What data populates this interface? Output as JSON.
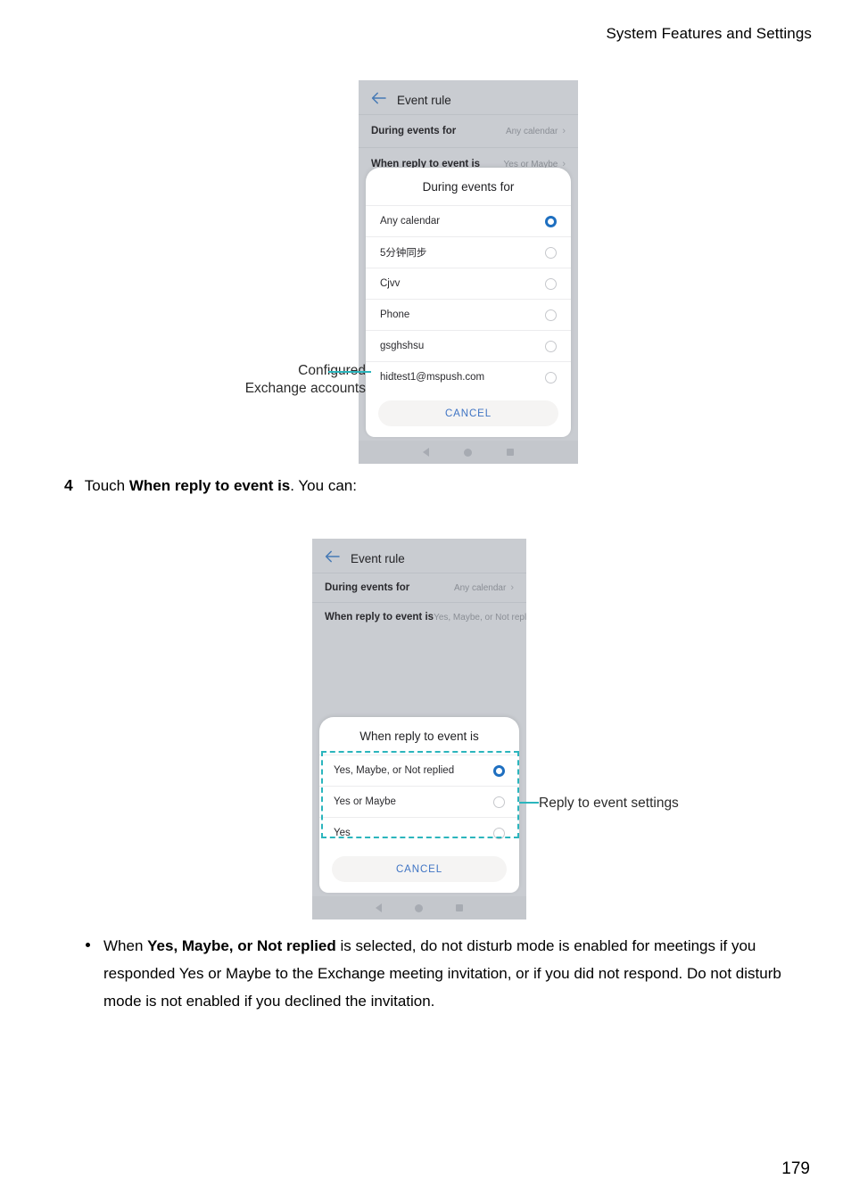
{
  "document": {
    "header": "System Features and Settings",
    "page_number": "179"
  },
  "step": {
    "number": "4",
    "text_before": "Touch ",
    "bold": "When reply to event is",
    "text_after": ". You can:"
  },
  "bullet": {
    "text_before": "When ",
    "bold": "Yes, Maybe, or Not replied",
    "text_after": " is selected, do not disturb mode is enabled for meetings if you responded Yes or Maybe to the Exchange meeting invitation, or if you did not respond. Do not disturb mode is not enabled if you declined the invitation."
  },
  "screenshot_one": {
    "appbar_title": "Event rule",
    "settings_rows": [
      {
        "label": "During events for",
        "value": "Any calendar"
      },
      {
        "label": "When reply to event is",
        "value": "Yes or Maybe"
      }
    ],
    "sheet_title": "During events for",
    "options": [
      {
        "label": "Any calendar",
        "selected": true
      },
      {
        "label": "5分钟同步",
        "selected": false
      },
      {
        "label": "Cjvv",
        "selected": false
      },
      {
        "label": "Phone",
        "selected": false
      },
      {
        "label": "gsghshsu",
        "selected": false
      },
      {
        "label": "hidtest1@mspush.com",
        "selected": false
      }
    ],
    "cancel_label": "CANCEL",
    "annotation": "Configured\nExchange accounts"
  },
  "screenshot_two": {
    "appbar_title": "Event rule",
    "settings_rows": [
      {
        "label": "During events for",
        "value": "Any calendar"
      },
      {
        "label": "When reply to event is",
        "value": "Yes, Maybe, or Not replied"
      }
    ],
    "sheet_title": "When reply to event is",
    "options": [
      {
        "label": "Yes, Maybe, or Not replied",
        "selected": true
      },
      {
        "label": "Yes or Maybe",
        "selected": false
      },
      {
        "label": "Yes",
        "selected": false
      }
    ],
    "cancel_label": "CANCEL",
    "annotation": "Reply to event settings"
  },
  "colors": {
    "accent_teal": "#2bb5bd",
    "radio_blue": "#1e6fc0",
    "cancel_blue": "#3f74c4",
    "phone_bg": "#c9ccd1"
  }
}
